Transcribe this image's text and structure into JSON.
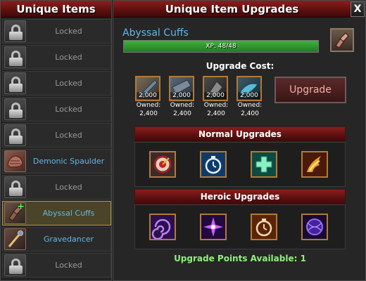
{
  "left_panel": {
    "title": "Unique Items",
    "items": [
      {
        "label": "Locked",
        "locked": true
      },
      {
        "label": "Locked",
        "locked": true
      },
      {
        "label": "Locked",
        "locked": true
      },
      {
        "label": "Locked",
        "locked": true
      },
      {
        "label": "Locked",
        "locked": true
      },
      {
        "label": "Demonic Spaulder",
        "locked": false,
        "icon": "spaulder-icon"
      },
      {
        "label": "Locked",
        "locked": true
      },
      {
        "label": "Abyssal Cuffs",
        "locked": false,
        "selected": true,
        "icon": "cuffs-icon"
      },
      {
        "label": "Gravedancer",
        "locked": false,
        "icon": "gravedancer-icon"
      },
      {
        "label": "Locked",
        "locked": true
      }
    ]
  },
  "right_panel": {
    "title": "Unique Item Upgrades",
    "close_label": "X",
    "item_name": "Abyssal Cuffs",
    "xp_text": "XP: 48/48",
    "xp_fraction": 1.0,
    "upgrade_cost_label": "Upgrade Cost:",
    "costs": [
      {
        "count": "2,000",
        "owned_label": "Owned:",
        "owned": "2,400",
        "icon": "material-1-icon"
      },
      {
        "count": "2,000",
        "owned_label": "Owned:",
        "owned": "2,400",
        "icon": "material-2-icon"
      },
      {
        "count": "2,000",
        "owned_label": "Owned:",
        "owned": "2,400",
        "icon": "material-3-icon"
      },
      {
        "count": "2,000",
        "owned_label": "Owned:",
        "owned": "2,400",
        "icon": "material-4-icon"
      }
    ],
    "upgrade_button": "Upgrade",
    "normal_upgrades_title": "Normal Upgrades",
    "normal_upgrades": [
      "target-icon",
      "stopwatch-icon",
      "cross-icon",
      "flame-claw-icon"
    ],
    "heroic_upgrades_title": "Heroic Upgrades",
    "heroic_upgrades": [
      "vortex-icon",
      "starburst-icon",
      "timer-icon",
      "sphere-icon"
    ],
    "upgrade_points": "Upgrade Points Available: 1"
  },
  "colors": {
    "header_red": "#8b1e1e",
    "item_name_blue": "#62b8e6",
    "xp_green": "#3fb13f",
    "points_green": "#8ef07a",
    "slot_border": "#b07a3a"
  }
}
